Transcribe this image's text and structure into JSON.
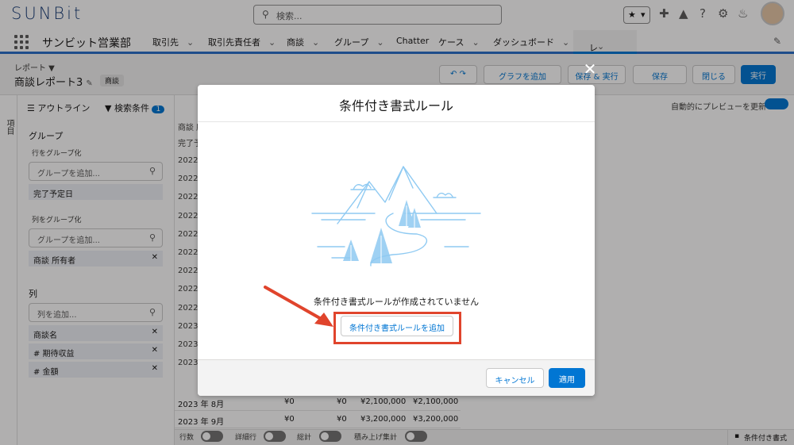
{
  "app": {
    "logo": "SUNBit",
    "name": "サンビット営業部",
    "search_placeholder": "検索..."
  },
  "nav": {
    "items": [
      "取引先",
      "取引先責任者",
      "商談",
      "グループ",
      "Chatter",
      "ケース",
      "ダッシュボード"
    ],
    "active": "レポート"
  },
  "report": {
    "breadcrumb": "レポート ▼",
    "title": "商談レポート3",
    "badge": "商談",
    "buttons": {
      "chart": "グラフを追加",
      "save_run": "保存 & 実行",
      "save": "保存",
      "close": "閉じる",
      "run": "実行"
    },
    "autopreview": "自動的にプレビューを更新"
  },
  "sidebar": {
    "vertical_tab": "項目",
    "tab_outline": "アウトライン",
    "tab_filters": "検索条件",
    "filter_count": "1",
    "groups_title": "グループ",
    "group_rows_label": "行をグループ化",
    "group_rows_placeholder": "グループを追加...",
    "group_rows_chip": "完了予定日",
    "group_cols_label": "列をグループ化",
    "group_cols_placeholder": "グループを追加...",
    "group_cols_chip": "商談 所有者",
    "columns_title": "列",
    "columns_placeholder": "列を追加...",
    "columns": [
      "商談名",
      "# 期待収益",
      "# 金額"
    ]
  },
  "table": {
    "year_rows": [
      "2022",
      "2022",
      "2022",
      "2022",
      "2022",
      "2022",
      "2022",
      "2022",
      "2022",
      "2023",
      "2023",
      "2023"
    ],
    "header_a": "商談 所",
    "header_b": "完了予",
    "rows": [
      {
        "month": "2023 年 8月",
        "v1": "¥0",
        "v2": "¥0",
        "v3": "¥2,100,000",
        "v4": "¥2,100,000"
      },
      {
        "month": "2023 年 9月",
        "v1": "¥0",
        "v2": "¥0",
        "v3": "¥3,200,000",
        "v4": "¥3,200,000"
      }
    ]
  },
  "bottom_bar": {
    "toggles": [
      "行数",
      "詳細行",
      "総計",
      "積み上げ集計"
    ],
    "cf_button": "条件付き書式"
  },
  "modal": {
    "title": "条件付き書式ルール",
    "empty_text": "条件付き書式ルールが作成されていません",
    "add_button": "条件付き書式ルールを追加",
    "cancel": "キャンセル",
    "apply": "適用",
    "close_icon": "close-icon"
  },
  "colors": {
    "brand": "#0176d3",
    "annotation": "#e0442c",
    "illustration": "#8fcaf2"
  }
}
